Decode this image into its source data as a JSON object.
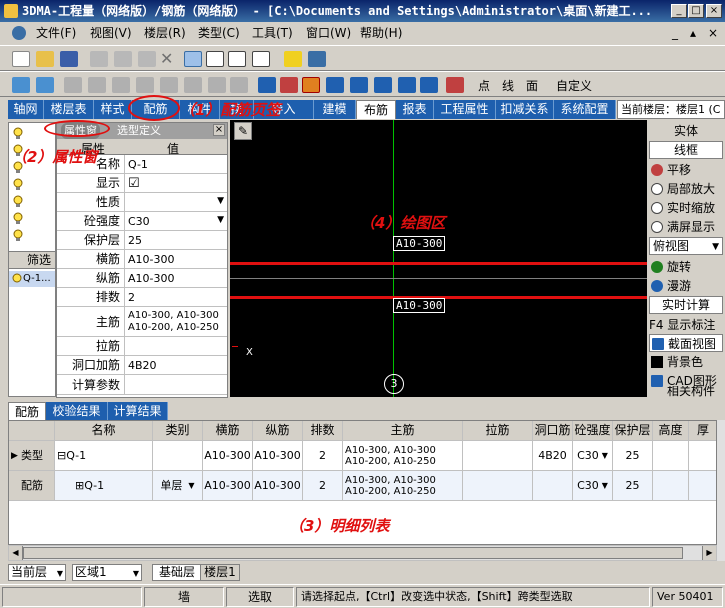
{
  "titlebar": {
    "title": "3DMA-工程量（网络版）/钢筋（网络版） - [C:\\Documents and Settings\\Administrator\\桌面\\新建工..."
  },
  "menu": [
    {
      "label": "文件(F)"
    },
    {
      "label": "视图(V)"
    },
    {
      "label": "楼层(R)"
    },
    {
      "label": "类型(C)"
    },
    {
      "label": "工具(T)"
    },
    {
      "label": "窗口(W)"
    },
    {
      "label": "帮助(H)"
    }
  ],
  "toolbar2": {
    "points": "点",
    "line": "线",
    "face": "面",
    "custom": "自定义"
  },
  "tabs": [
    {
      "label": "轴网"
    },
    {
      "label": "楼层表"
    },
    {
      "label": "样式"
    },
    {
      "label": "配筋"
    },
    {
      "label": "构件"
    },
    {
      "label": "换"
    },
    {
      "label": "导入"
    },
    {
      "label": "建模"
    },
    {
      "label": "布筋"
    },
    {
      "label": "报表"
    },
    {
      "label": "工程属性"
    },
    {
      "label": "扣减关系"
    },
    {
      "label": "系统配置"
    }
  ],
  "current_floor": "当前楼层：楼层1 (C",
  "left": {
    "filter_label": "筛选",
    "tree_item": "Q-1..."
  },
  "property_window": {
    "title": "属性窗",
    "tab2": "选型定义",
    "col_name": "属性",
    "col_value": "值",
    "rows": [
      {
        "name": "名称",
        "value": "Q-1"
      },
      {
        "name": "显示",
        "value": "☑"
      },
      {
        "name": "性质",
        "value": ""
      },
      {
        "name": "砼强度",
        "value": "C30"
      },
      {
        "name": "保护层",
        "value": "25"
      },
      {
        "name": "横筋",
        "value": "A10-300"
      },
      {
        "name": "纵筋",
        "value": "A10-300"
      },
      {
        "name": "排数",
        "value": "2"
      },
      {
        "name": "主筋",
        "value": "A10-300, A10-300\nA10-200, A10-250"
      },
      {
        "name": "拉筋",
        "value": ""
      },
      {
        "name": "洞口加筋",
        "value": "4B20"
      },
      {
        "name": "计算参数",
        "value": ""
      }
    ]
  },
  "annotations": {
    "a1": "（1）配筋页签",
    "a2": "（2）属性窗",
    "a3": "（3）明细列表",
    "a4": "（4）绘图区"
  },
  "canvas": {
    "label_top": "A10-300",
    "label_bottom": "A10-300",
    "axis_number": "3",
    "x_marker": "X"
  },
  "right_panel": {
    "solid": "实体",
    "wireframe": "线框",
    "items": [
      {
        "label": "平移",
        "icon": "pan-icon"
      },
      {
        "label": "局部放大",
        "icon": "zoom-window-icon"
      },
      {
        "label": "实时缩放",
        "icon": "zoom-realtime-icon"
      },
      {
        "label": "满屏显示",
        "icon": "fit-screen-icon"
      }
    ],
    "view_select": "俯视图",
    "items2": [
      {
        "label": "旋转",
        "icon": "rotate-icon"
      },
      {
        "label": "漫游",
        "icon": "walk-icon"
      }
    ],
    "realtime_calc": "实时计算",
    "f4": "F4 显示标注",
    "section_view": "截面视图",
    "bg_color": "背景色",
    "cad": "CAD图形",
    "related": "相关构件"
  },
  "bottom_tabs": [
    {
      "label": "配筋"
    },
    {
      "label": "校验结果"
    },
    {
      "label": "计算结果"
    }
  ],
  "grid": {
    "headers": [
      "名称",
      "类别",
      "横筋",
      "纵筋",
      "排数",
      "主筋",
      "拉筋",
      "洞口筋",
      "砼强度",
      "保护层",
      "高度",
      "厚"
    ],
    "rows": [
      {
        "kind": "类型",
        "name": "⊟Q-1",
        "category": "",
        "h": "A10-300",
        "v": "A10-300",
        "rows": "2",
        "main": "A10-300, A10-300\nA10-200, A10-250",
        "tie": "",
        "hole": "4B20",
        "conc": "C30",
        "cover": "25"
      },
      {
        "kind": "配筋",
        "name": "⊞Q-1",
        "category": "单层",
        "h": "A10-300",
        "v": "A10-300",
        "rows": "2",
        "main": "A10-300, A10-300\nA10-200, A10-250",
        "tie": "",
        "hole": "",
        "conc": "C30",
        "cover": "25"
      }
    ]
  },
  "floorbar": {
    "current_floor": "当前层",
    "region": "区域1",
    "tab1": "基础层",
    "tab2": "楼层1"
  },
  "status": {
    "type": "墙",
    "mode": "选取",
    "hint": "请选择起点,【Ctrl】改变选中状态,【Shift】跨类型选取",
    "version": "Ver 50401"
  },
  "colors": {
    "tab_blue": "#1e5fae",
    "annotation_red": "#e01010",
    "rebar_red": "#e01010",
    "axis_green": "#00c000"
  }
}
